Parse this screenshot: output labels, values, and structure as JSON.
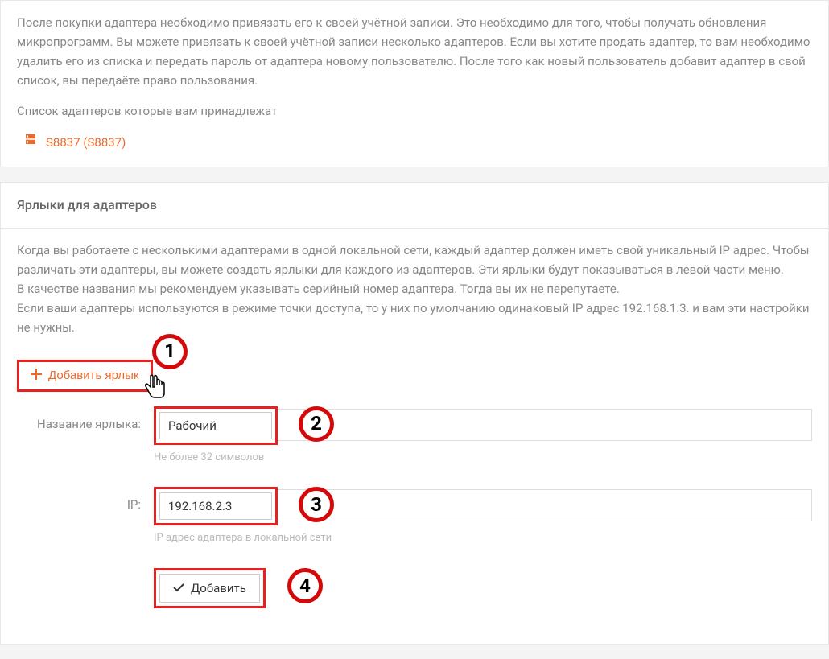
{
  "intro": {
    "text": "После покупки адаптера необходимо привязать его к своей учётной записи. Это необходимо для того, чтобы получать обновления микропрограмм. Вы можете привязать к своей учётной записи несколько адаптеров. Если вы хотите продать адаптер, то вам необходимо удалить его из списка и передать пароль от адаптера новому пользователю. После того как новый пользователь добавит адаптер в свой список, вы передаёте право пользования.",
    "list_label": "Список адаптеров которые вам принадлежат",
    "adapter_link": "S8837 (S8837)"
  },
  "shortcuts": {
    "header": "Ярлыки для адаптеров",
    "description": "Когда вы работаете с несколькими адаптерами в одной локальной сети, каждый адаптер должен иметь свой уникальный IP адрес. Чтобы различать эти адаптеры, вы можете создать ярлыки для каждого из адаптеров. Эти ярлыки будут показываться в левой части меню.\nВ качестве названия мы рекомендуем указывать серийный номер адаптера. Тогда вы их не перепутаете.\nЕсли ваши адаптеры используются в режиме точки доступа, то у них по умолчанию одинаковый IP адрес 192.168.1.3. и вам эти настройки не нужны.",
    "add_button": "Добавить ярлык",
    "name_label": "Название ярлыка:",
    "name_value": "Рабочий",
    "name_hint": "Не более 32 символов",
    "ip_label": "IP:",
    "ip_value": "192.168.2.3",
    "ip_hint": "IP адрес адаптера в локальной сети",
    "submit_label": "Добавить"
  },
  "annotations": {
    "n1": "1",
    "n2": "2",
    "n3": "3",
    "n4": "4"
  }
}
